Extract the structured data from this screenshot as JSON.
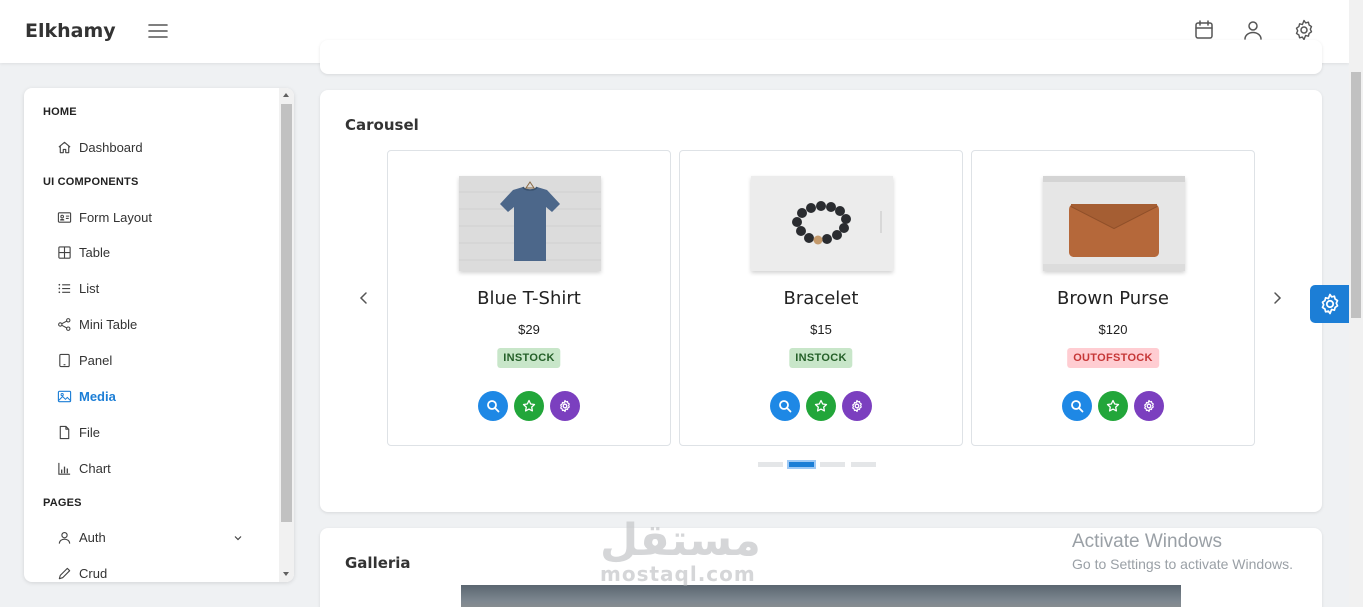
{
  "app": {
    "brand": "Elkhamy"
  },
  "sidebar": {
    "sections": [
      {
        "label": "HOME"
      },
      {
        "label": "UI COMPONENTS"
      },
      {
        "label": "PAGES"
      }
    ],
    "items": [
      {
        "label": "Dashboard",
        "icon": "home-icon"
      },
      {
        "label": "Form Layout",
        "icon": "id-card-icon"
      },
      {
        "label": "Table",
        "icon": "table-icon"
      },
      {
        "label": "List",
        "icon": "list-icon"
      },
      {
        "label": "Mini Table",
        "icon": "share-icon"
      },
      {
        "label": "Panel",
        "icon": "tablet-icon"
      },
      {
        "label": "Media",
        "icon": "image-icon",
        "active": true
      },
      {
        "label": "File",
        "icon": "file-icon"
      },
      {
        "label": "Chart",
        "icon": "chart-bar-icon"
      },
      {
        "label": "Auth",
        "icon": "user-icon"
      },
      {
        "label": "Crud",
        "icon": "pencil-icon"
      }
    ]
  },
  "carousel": {
    "title": "Carousel",
    "products": [
      {
        "name": "Blue T-Shirt",
        "price": "$29",
        "status": "INSTOCK"
      },
      {
        "name": "Bracelet",
        "price": "$15",
        "status": "INSTOCK"
      },
      {
        "name": "Brown Purse",
        "price": "$120",
        "status": "OUTOFSTOCK"
      }
    ],
    "page_count": 4,
    "active_page": 2
  },
  "galleria": {
    "title": "Galleria"
  },
  "watermark": {
    "activate_title": "Activate Windows",
    "activate_sub": "Go to Settings to activate Windows.",
    "logo_text": "مستقل",
    "logo_sub": "mostaql.com"
  },
  "colors": {
    "accent": "#1c7ed6",
    "instock_bg": "#c8e6c9",
    "instock_fg": "#256029",
    "outofstock_bg": "#ffcdd2",
    "outofstock_fg": "#c63737",
    "btn_blue": "#1e88e5",
    "btn_green": "#22a63a",
    "btn_purple": "#7b3fbf"
  }
}
